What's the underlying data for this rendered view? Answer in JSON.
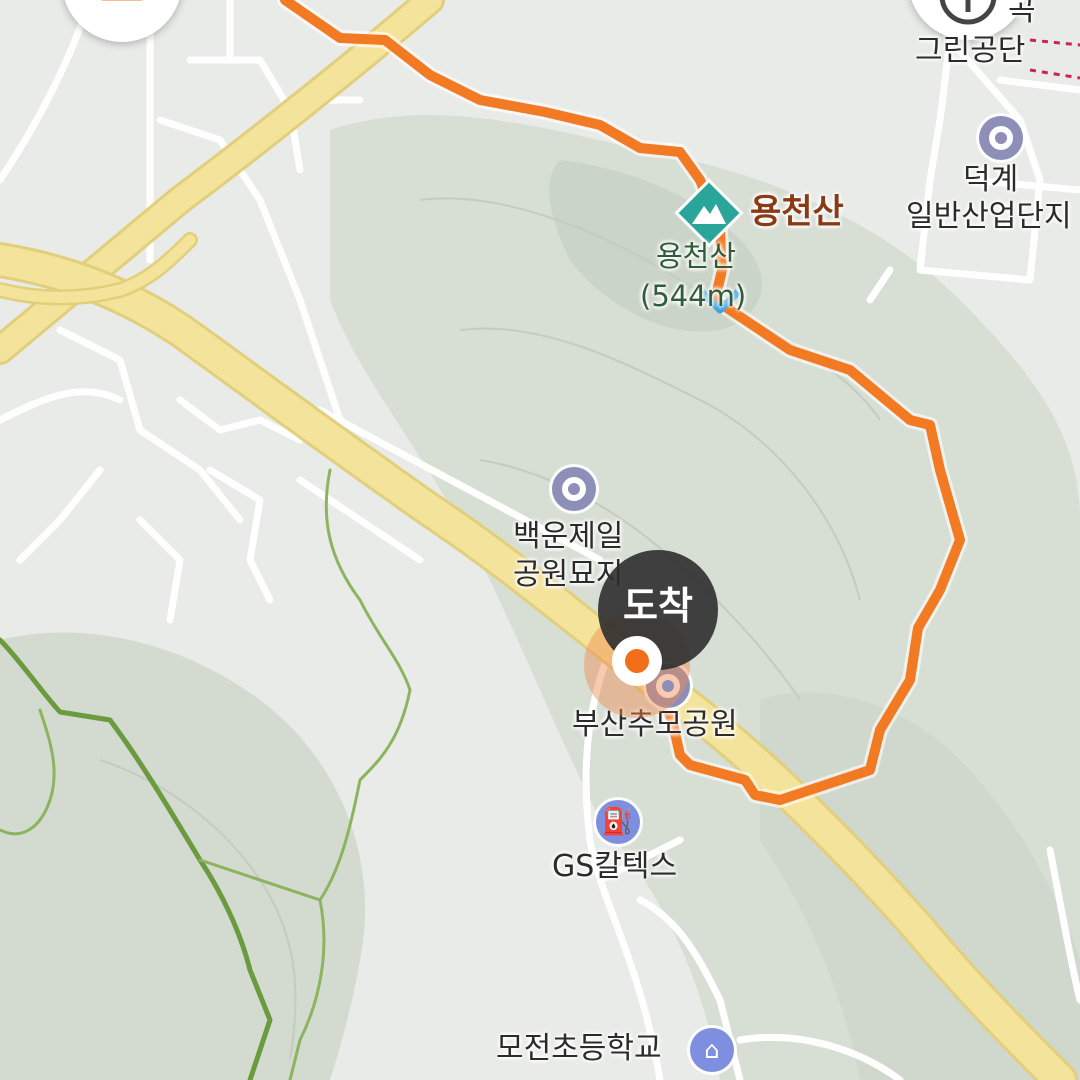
{
  "map": {
    "colors": {
      "background": "#e9ebe8",
      "forest": "#d6ddd3",
      "forest_dark": "#c9d2c6",
      "highway_fill": "#f4e39a",
      "highway_edge": "#e2cf7c",
      "minor_road": "#ffffff",
      "route": "#f27a22",
      "trail": "#6c9a3e",
      "trail_light": "#8cb45e",
      "rail": "#c8254f"
    },
    "peak": {
      "name": "용천산",
      "sub_name": "용천산",
      "elevation_label": "(544m)",
      "icon": "mountain-icon"
    },
    "labels": {
      "top_right_1": "곡",
      "top_right_2": "그린공단",
      "industrial_1": "덕계",
      "industrial_2": "일반산업단지",
      "cemetery_1": "백운제일",
      "cemetery_2": "공원묘지",
      "memorial_park": "부산추모공원",
      "gas_station": "GS칼텍스",
      "school": "모전초등학교"
    },
    "destination": {
      "badge_text": "도착",
      "icon": "destination-dot-icon"
    },
    "icons": {
      "poi": "place-icon",
      "fuel": "fuel-icon",
      "school": "school-icon",
      "top_left": "camp-icon",
      "top_right": "compass-icon"
    }
  }
}
